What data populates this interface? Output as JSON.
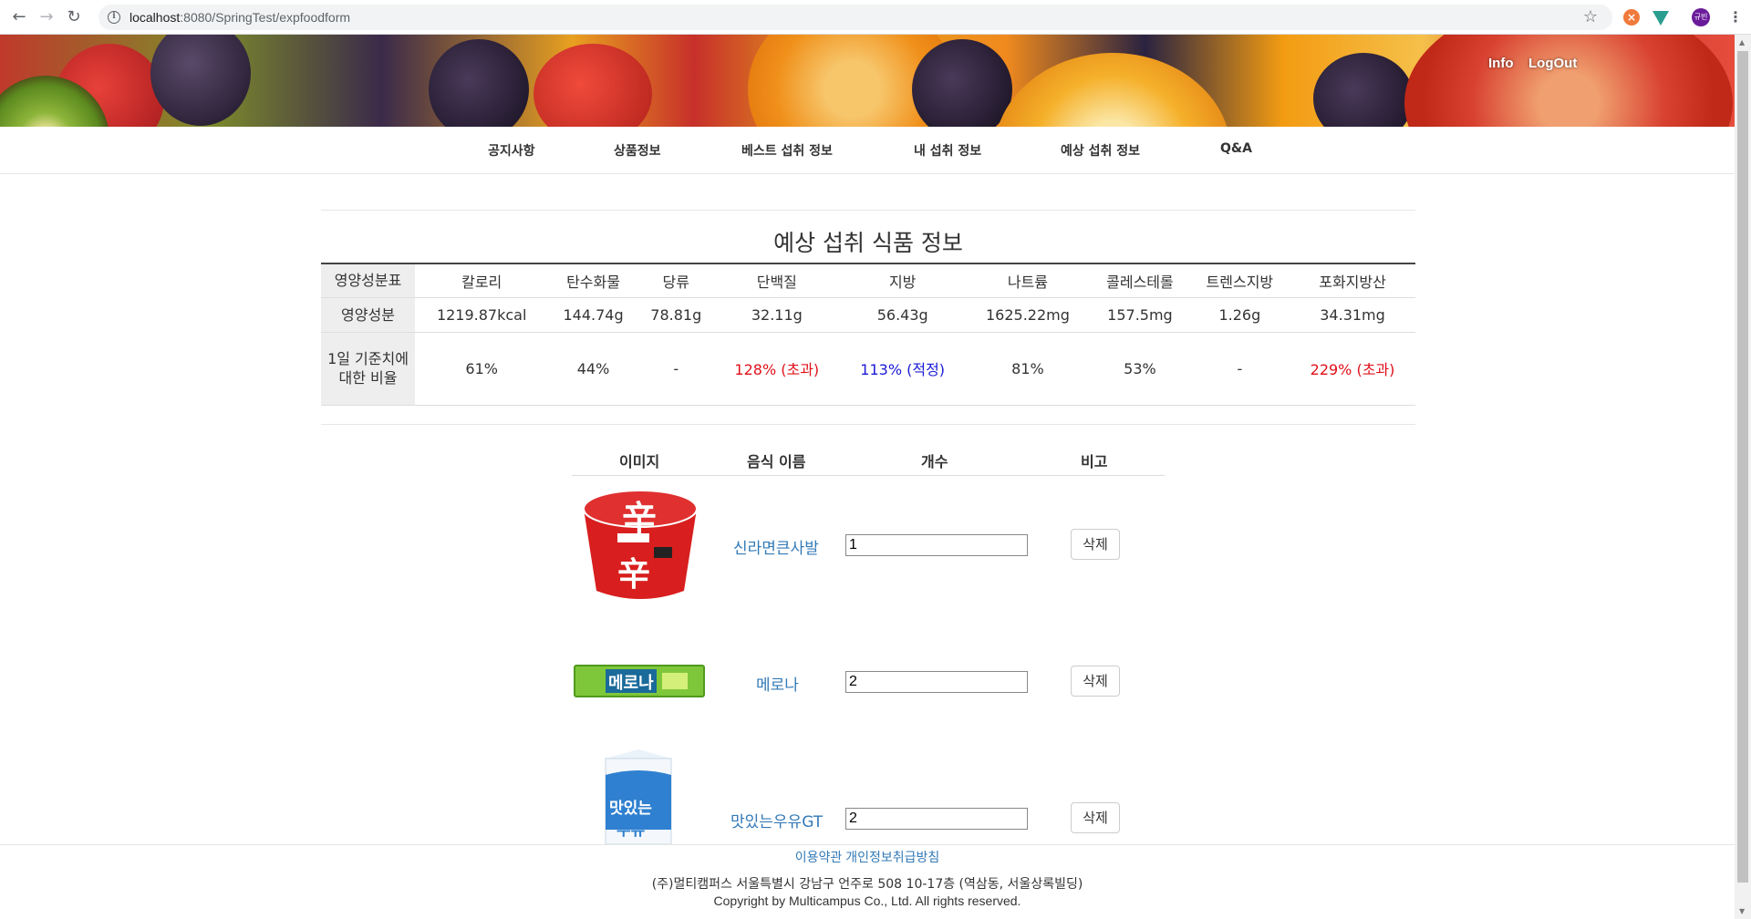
{
  "browser": {
    "url_host": "localhost",
    "url_path": ":8080/SpringTest/expfoodform",
    "avatar_text": "규빈"
  },
  "header": {
    "info_label": "Info",
    "logout_label": "LogOut"
  },
  "menu": {
    "items": [
      "공지사항",
      "상품정보",
      "베스트 섭취 정보",
      "내 섭취 정보",
      "예상 섭취 정보",
      "Q&A"
    ]
  },
  "page_title": "예상 섭취 식품 정보",
  "nutrition": {
    "header_label": "영양성분표",
    "columns": [
      "칼로리",
      "탄수화물",
      "당류",
      "단백질",
      "지방",
      "나트륨",
      "콜레스테롤",
      "트렌스지방",
      "포화지방산"
    ],
    "values_label": "영양성분",
    "values": [
      "1219.87kcal",
      "144.74g",
      "78.81g",
      "32.11g",
      "56.43g",
      "1625.22mg",
      "157.5mg",
      "1.26g",
      "34.31mg"
    ],
    "ratio_label": "1일 기준치에 대한 비율",
    "ratios": [
      "61%",
      "44%",
      "-",
      "128% (초과)",
      "113% (적정)",
      "81%",
      "53%",
      "-",
      "229% (초과)"
    ],
    "ratio_status": [
      "",
      "",
      "",
      "over",
      "ok",
      "",
      "",
      "",
      "over"
    ]
  },
  "food_table": {
    "headers": [
      "이미지",
      "음식 이름",
      "개수",
      "비고"
    ],
    "rows": [
      {
        "name": "신라면큰사발",
        "qty": "1",
        "action": "삭제",
        "image": "ramen-cup"
      },
      {
        "name": "메로나",
        "qty": "2",
        "action": "삭제",
        "image": "melona-bar"
      },
      {
        "name": "맛있는우유GT",
        "qty": "2",
        "action": "삭제",
        "image": "milk-carton"
      }
    ]
  },
  "footer": {
    "terms": "이용약관",
    "privacy": "개인정보취급방침",
    "address": "(주)멀티캠퍼스 서울특별시 강남구 언주로 508 10-17층 (역삼동, 서울상록빌딩)",
    "copyright": "Copyright by Multicampus Co., Ltd. All rights reserved."
  },
  "colors": {
    "over": "#e0101a",
    "ok": "#1a1ad6",
    "link": "#337ab7"
  }
}
